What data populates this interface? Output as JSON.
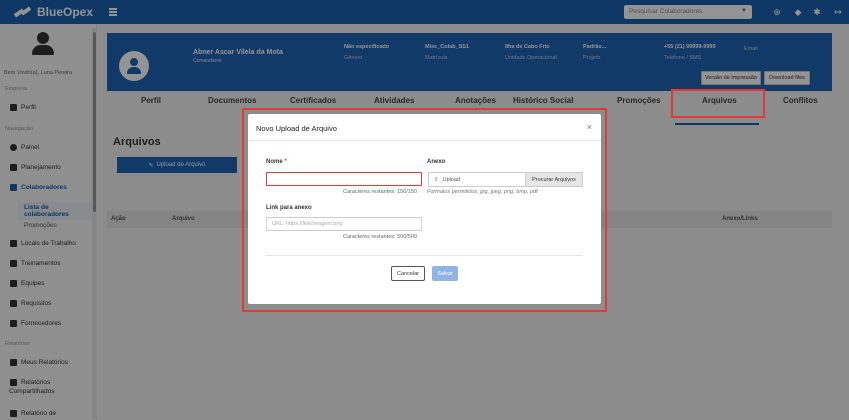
{
  "app": {
    "name": "BlueOpex"
  },
  "topbar": {
    "search_placeholder": "Pesquisar Colaboradores"
  },
  "sidebar": {
    "welcome": "Bem Vindo(a), Luna Pereira",
    "section_empresa": "Empresa",
    "item_perfil": "Perfil",
    "section_navegacao": "Navegação",
    "items": [
      "Painel",
      "Planejamento",
      "Colaboradores"
    ],
    "sub_items": [
      "Lista de colaboradores",
      "Promoções"
    ],
    "items_b": [
      "Locais de Trabalho",
      "Treinamentos",
      "Equipes",
      "Requisitos",
      "Fornecedores"
    ],
    "section_relatorios": "Relatórios",
    "items_c": [
      "Meus Relatórios",
      "Relatórios Compartilhados",
      "Relatório de"
    ]
  },
  "profile": {
    "name": "Abner Ascar Vilela da Mota",
    "role": "Comandante",
    "fields": [
      {
        "value": "Não especificado",
        "label": "Gênero"
      },
      {
        "value": "Misc_Colab_SS1",
        "label": "Matrícula"
      },
      {
        "value": "Ilha de Cabo Frio",
        "label": "Unidade Operacional"
      },
      {
        "value": "Padrão...",
        "label": "Projeto"
      },
      {
        "value": "+55 (21) 99999-9999",
        "label": "Telefone / SMS"
      },
      {
        "value": "",
        "label": "Email"
      }
    ],
    "btn_print": "Versão de Impressão",
    "btn_download": "Download files"
  },
  "tabs": [
    "Perfil",
    "Documentos",
    "Certificados",
    "Atividades",
    "Anotações",
    "Histórico Social",
    "Promoções",
    "Arquivos",
    "Conflitos"
  ],
  "main": {
    "title": "Arquivos",
    "upload_btn": "Upload de Arquivo",
    "columns": [
      "Ação",
      "Arquivo",
      "Anexo/Links"
    ]
  },
  "modal": {
    "title": "Novo Upload de Arquivo",
    "nome_label": "Nome",
    "nome_required": "*",
    "nome_value": "",
    "nome_counter": "Caracteres restantes: 150/150",
    "link_label": "Link para anexo",
    "link_placeholder": "URL: https://link/imagem.png",
    "link_counter": "Caracteres restantes: 500/500",
    "anexo_label": "Anexo",
    "upload_text": "Upload",
    "browse_btn": "Procurar Arquivos",
    "formats_hint": "Formatos permitidos: jpg, jpeg, png, bmp, pdf",
    "cancel": "Cancelar",
    "save": "Salvar"
  }
}
